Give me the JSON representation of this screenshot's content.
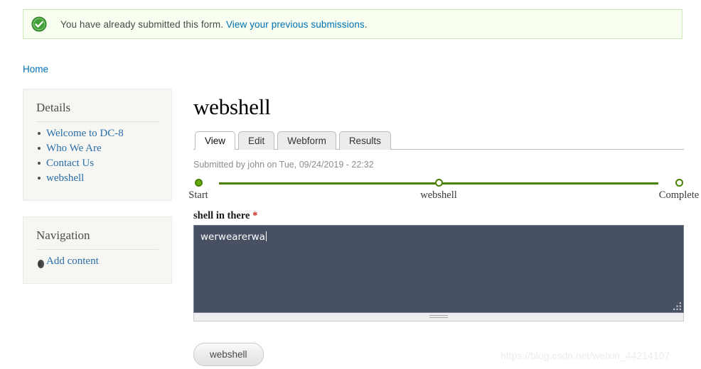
{
  "message": {
    "icon": "success-check-icon",
    "text_before": "You have already submitted this form. ",
    "link_text": "View your previous submissions",
    "text_after": ".",
    "bg_color": "#f8fff0",
    "border_color": "#c9e7b7",
    "icon_color": "#3f9e35"
  },
  "breadcrumb": {
    "home_label": "Home"
  },
  "sidebar": {
    "blocks": [
      {
        "title": "Details",
        "items": [
          {
            "label": "Welcome to DC-8"
          },
          {
            "label": "Who We Are"
          },
          {
            "label": "Contact Us"
          },
          {
            "label": "webshell"
          }
        ]
      },
      {
        "title": "Navigation",
        "items": [
          {
            "label": "Add content"
          }
        ]
      }
    ]
  },
  "main": {
    "page_title": "webshell",
    "tabs": [
      {
        "label": "View",
        "active": true
      },
      {
        "label": "Edit",
        "active": false
      },
      {
        "label": "Webform",
        "active": false
      },
      {
        "label": "Results",
        "active": false
      }
    ],
    "submitted_line": "Submitted by john on Tue, 09/24/2019 - 22:32",
    "progress": {
      "line_color": "#4a8000",
      "steps": [
        {
          "label": "Start",
          "state": "done"
        },
        {
          "label": "webshell",
          "state": "pending"
        },
        {
          "label": "Complete",
          "state": "pending"
        }
      ]
    },
    "field": {
      "label": "shell in there",
      "required_mark": "*",
      "value": "werwearerwa",
      "bg_color": "#475163"
    },
    "submit_label": "webshell"
  },
  "watermark": {
    "text": "https://blog.csdn.net/weixin_44214107"
  }
}
